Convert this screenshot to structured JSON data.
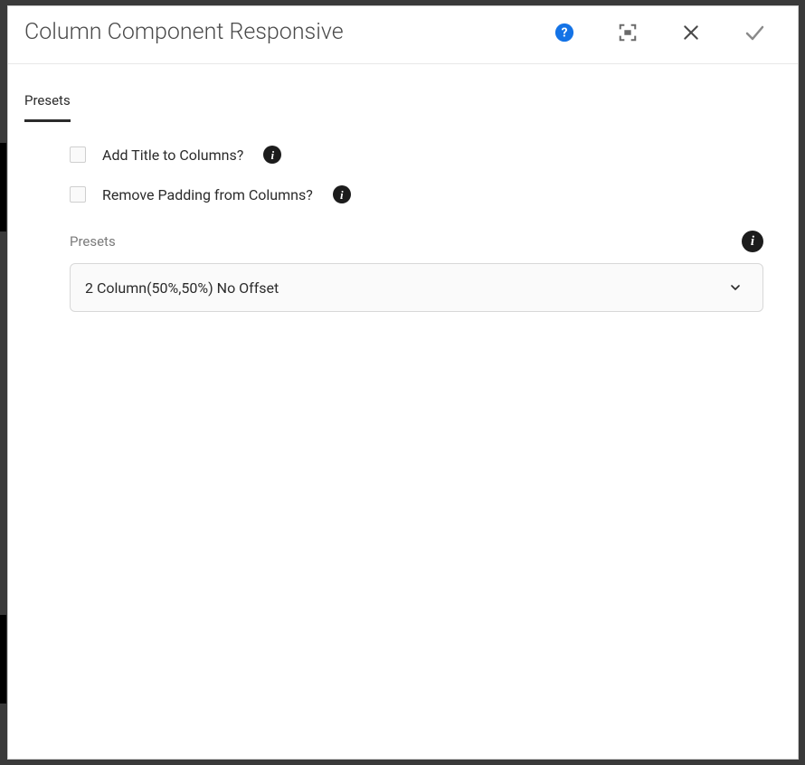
{
  "dialog": {
    "title": "Column Component Responsive"
  },
  "tabs": {
    "presets": "Presets"
  },
  "form": {
    "addTitleLabel": "Add Title to Columns?",
    "removePaddingLabel": "Remove Padding from Columns?",
    "presetsLabel": "Presets",
    "presetsValue": "2 Column(50%,50%) No Offset"
  },
  "icons": {
    "info": "i"
  }
}
